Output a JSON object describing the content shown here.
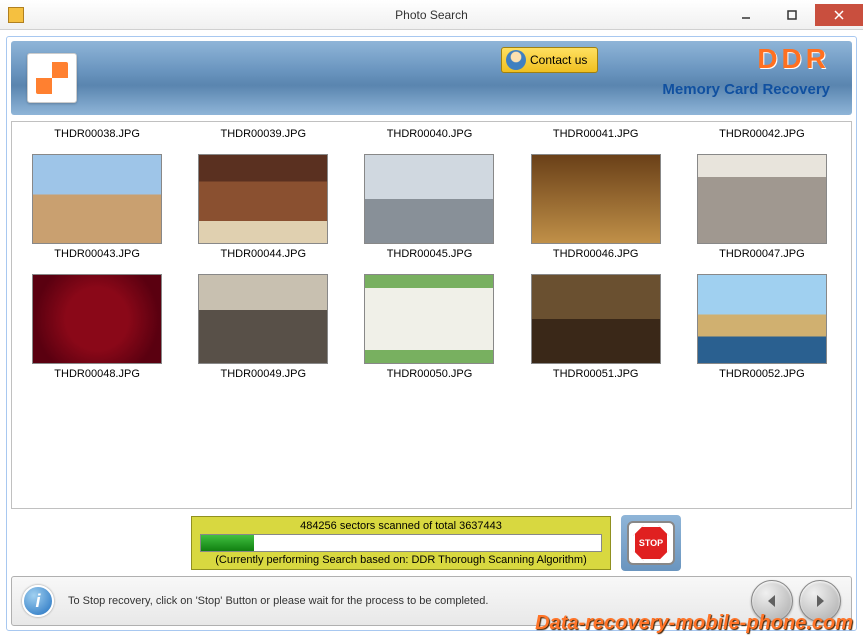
{
  "window": {
    "title": "Photo Search"
  },
  "header": {
    "contact_label": "Contact us",
    "brand": "DDR",
    "brand_sub": "Memory Card Recovery"
  },
  "photos_row1": [
    {
      "name": "THDR00038.JPG"
    },
    {
      "name": "THDR00039.JPG"
    },
    {
      "name": "THDR00040.JPG"
    },
    {
      "name": "THDR00041.JPG"
    },
    {
      "name": "THDR00042.JPG"
    }
  ],
  "photos_row2": [
    {
      "name": "THDR00043.JPG",
      "cls": "t43"
    },
    {
      "name": "THDR00044.JPG",
      "cls": "t44"
    },
    {
      "name": "THDR00045.JPG",
      "cls": "t45"
    },
    {
      "name": "THDR00046.JPG",
      "cls": "t46"
    },
    {
      "name": "THDR00047.JPG",
      "cls": "t47"
    }
  ],
  "photos_row3": [
    {
      "name": "THDR00048.JPG",
      "cls": "t48"
    },
    {
      "name": "THDR00049.JPG",
      "cls": "t49"
    },
    {
      "name": "THDR00050.JPG",
      "cls": "t50"
    },
    {
      "name": "THDR00051.JPG",
      "cls": "t51"
    },
    {
      "name": "THDR00052.JPG",
      "cls": "t52"
    }
  ],
  "progress": {
    "status_text": "484256 sectors scanned of total 3637443",
    "sectors_scanned": 484256,
    "sectors_total": 3637443,
    "percent": 13.3,
    "algorithm_text": "(Currently performing Search based on:  DDR Thorough Scanning Algorithm)",
    "stop_label": "STOP"
  },
  "footer": {
    "info_glyph": "i",
    "info_text": "To Stop recovery, click on 'Stop' Button or please wait for the process to be completed."
  },
  "watermark": "Data-recovery-mobile-phone.com"
}
